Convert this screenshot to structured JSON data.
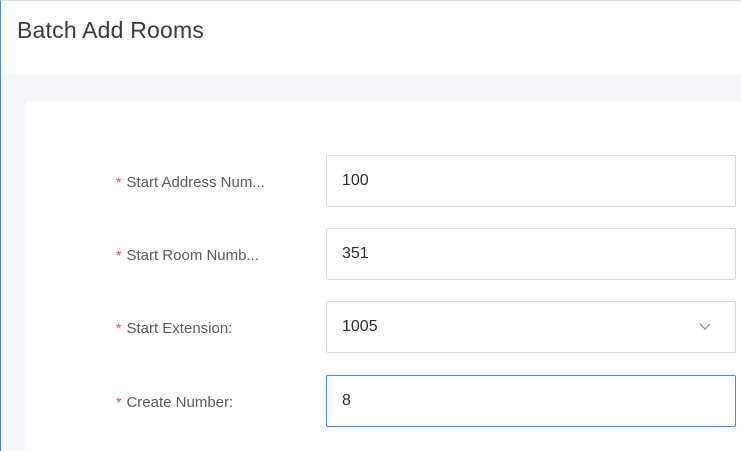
{
  "dialog": {
    "title": "Batch Add Rooms"
  },
  "form": {
    "required_mark": "*",
    "start_address": {
      "label": "Start Address Num...",
      "value": "100"
    },
    "start_room": {
      "label": "Start Room Numb...",
      "value": "351"
    },
    "start_extension": {
      "label": "Start Extension:",
      "value": "1005"
    },
    "create_number": {
      "label": "Create Number:",
      "value": "8"
    }
  },
  "icons": {
    "dropdown": "chevron-down-icon"
  },
  "colors": {
    "required": "#e8473b",
    "focus_border": "#3d8ee0",
    "field_border": "#d4d8de"
  }
}
